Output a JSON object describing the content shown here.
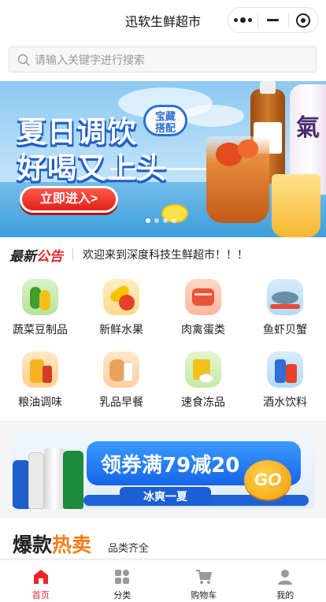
{
  "app": {
    "title": "迅软生鲜超市"
  },
  "capsule": {
    "more_icon": "more-dots-icon",
    "minimize_icon": "minimize-icon",
    "close_icon": "target-close-icon"
  },
  "search": {
    "placeholder": "请输入关键字进行搜索",
    "icon": "search-icon"
  },
  "banner": {
    "headline_1": "夏日调饮",
    "headline_2": "好喝又上头",
    "badge_line_1": "宝藏",
    "badge_line_2": "搭配",
    "cta": "立即进入>",
    "bottle_text": "氣",
    "slides": 4,
    "active_slide": 1
  },
  "notice": {
    "logo_part_1": "最新",
    "logo_part_2": "公告",
    "text": "欢迎来到深度科技生鲜超市！！！"
  },
  "categories": [
    {
      "label": "蔬菜豆制品",
      "icon": "vegetable-icon"
    },
    {
      "label": "新鲜水果",
      "icon": "fruit-icon"
    },
    {
      "label": "肉禽蛋类",
      "icon": "meat-icon"
    },
    {
      "label": "鱼虾贝蟹",
      "icon": "fish-icon"
    },
    {
      "label": "粮油调味",
      "icon": "oil-icon"
    },
    {
      "label": "乳品早餐",
      "icon": "bread-milk-icon"
    },
    {
      "label": "速食冻品",
      "icon": "instant-food-icon"
    },
    {
      "label": "酒水饮料",
      "icon": "drinks-icon"
    }
  ],
  "promo": {
    "headline": "领券满79减20",
    "sub": "冰爽一夏",
    "go": "GO"
  },
  "hot": {
    "title_part_1": "爆款",
    "title_part_2": "热卖",
    "subtitle": "品类齐全"
  },
  "tabbar": [
    {
      "label": "首页",
      "icon": "home-icon",
      "active": true
    },
    {
      "label": "分类",
      "icon": "category-icon",
      "active": false
    },
    {
      "label": "购物车",
      "icon": "cart-icon",
      "active": false
    },
    {
      "label": "我的",
      "icon": "user-icon",
      "active": false
    }
  ],
  "colors": {
    "accent": "#e8262a",
    "hot_orange": "#f27d18",
    "promo_blue": "#1565e8"
  }
}
